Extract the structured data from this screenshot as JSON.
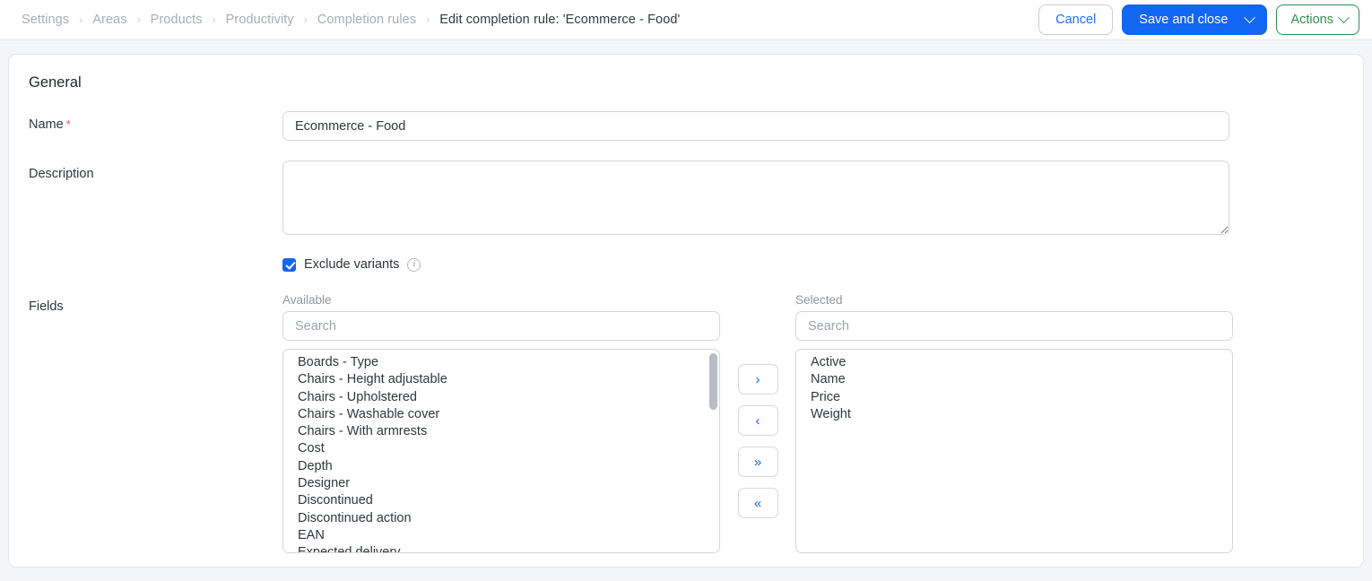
{
  "header": {
    "breadcrumb": [
      {
        "label": "Settings",
        "current": false
      },
      {
        "label": "Areas",
        "current": false
      },
      {
        "label": "Products",
        "current": false
      },
      {
        "label": "Productivity",
        "current": false
      },
      {
        "label": "Completion rules",
        "current": false
      },
      {
        "label": "Edit completion rule: 'Ecommerce - Food'",
        "current": true
      }
    ],
    "separator": "›",
    "cancel_label": "Cancel",
    "save_label": "Save and close",
    "actions_label": "Actions"
  },
  "colors": {
    "primary": "#1266f1",
    "link": "#1f6fff",
    "actions_green": "#2f8f4e",
    "required_red": "#e8635a",
    "page_bg": "#f4f5f6"
  },
  "general": {
    "section_title": "General",
    "name_label": "Name",
    "name_required_mark": "*",
    "name_value": "Ecommerce - Food",
    "name_placeholder": "",
    "description_label": "Description",
    "description_value": "",
    "description_placeholder": "",
    "exclude_variants_label": "Exclude variants",
    "exclude_variants_checked": true,
    "info_glyph": "i"
  },
  "fields": {
    "label": "Fields",
    "available": {
      "label": "Available",
      "search_value": "",
      "search_placeholder": "Search",
      "items": [
        "Boards - Type",
        "Chairs - Height adjustable",
        "Chairs - Upholstered",
        "Chairs - Washable cover",
        "Chairs - With armrests",
        "Cost",
        "Depth",
        "Designer",
        "Discontinued",
        "Discontinued action",
        "EAN",
        "Expected delivery"
      ]
    },
    "selected": {
      "label": "Selected",
      "search_value": "",
      "search_placeholder": "Search",
      "items": [
        "Active",
        "Name",
        "Price",
        "Weight"
      ]
    },
    "transfer_buttons": [
      {
        "name": "move-right",
        "glyph": "›"
      },
      {
        "name": "move-left",
        "glyph": "‹"
      },
      {
        "name": "move-all-right",
        "glyph": "»"
      },
      {
        "name": "move-all-left",
        "glyph": "«"
      }
    ]
  }
}
